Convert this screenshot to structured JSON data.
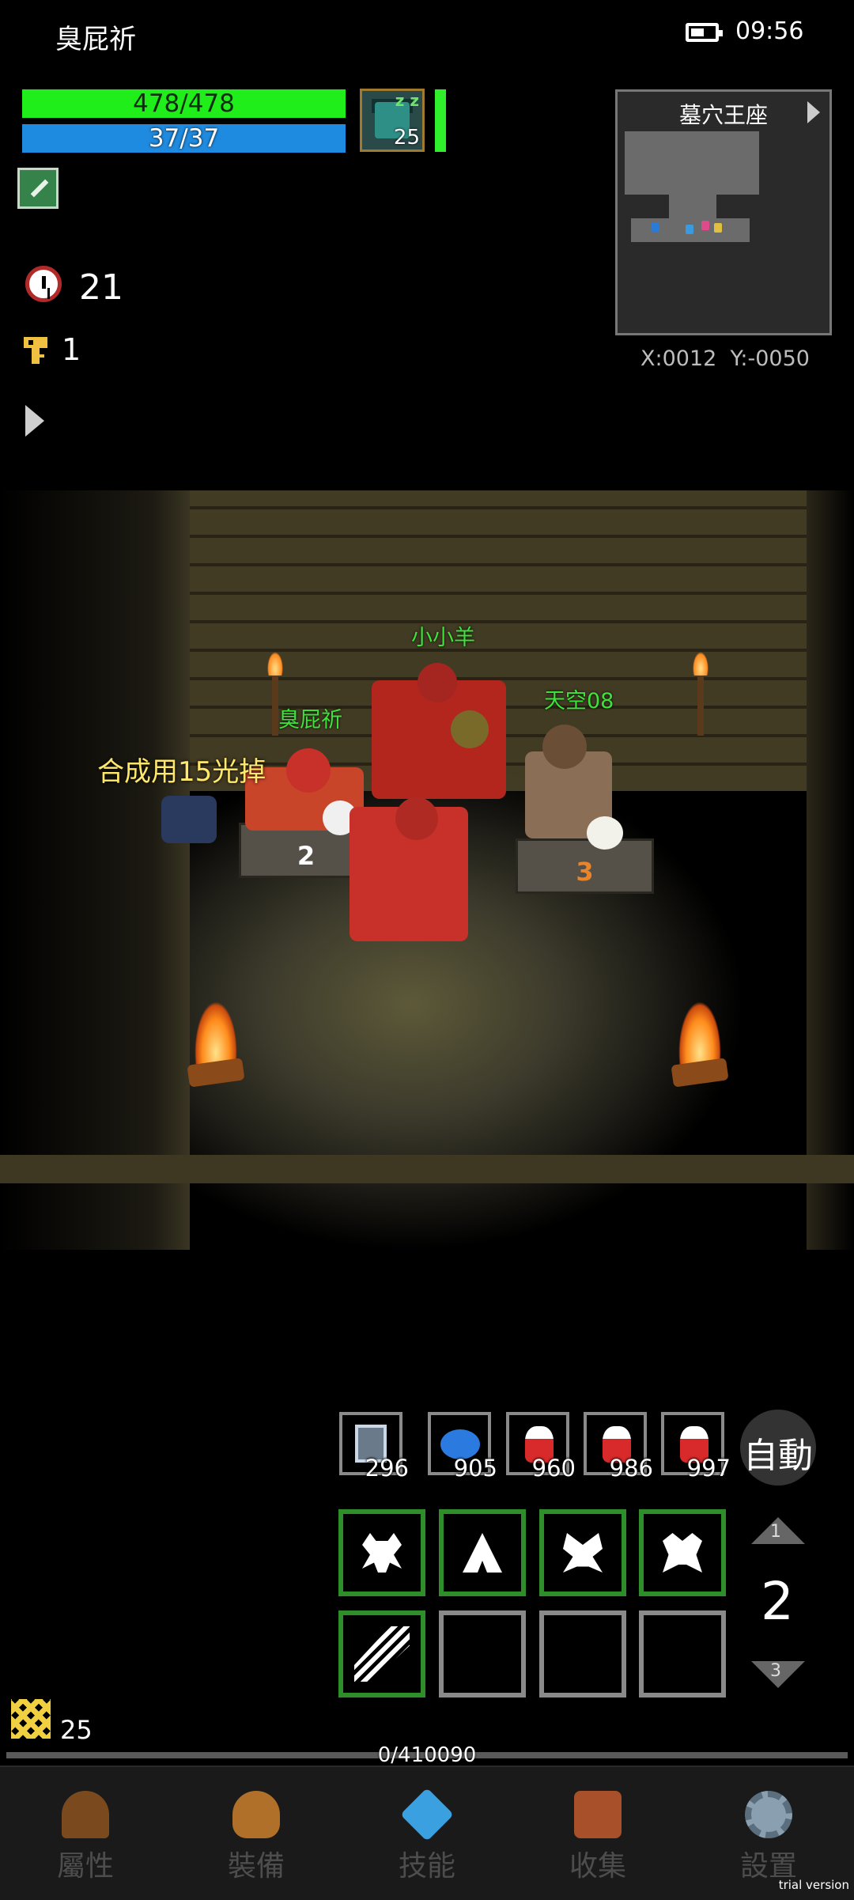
{
  "status_bar": {
    "player_name": "臭屁祈",
    "time": "09:56"
  },
  "player": {
    "hp": "478/478",
    "hp_fraction": 1.0,
    "mp": "37/37",
    "mp_fraction": 1.0,
    "portrait_level": "25",
    "sleep_mark": "z z",
    "timer_value": "21",
    "key_count": "1",
    "side_handle": "22"
  },
  "minimap": {
    "title": "墓穴王座",
    "coords": "X:0012  Y:-0050"
  },
  "scene": {
    "chat_message": "合成用15光掉",
    "names": [
      "小小羊",
      "天空08",
      "臭屁祈"
    ],
    "podiums": [
      "2",
      "3"
    ]
  },
  "consumables": [
    {
      "icon": "scroll-bottle-icon",
      "qty": "296"
    },
    {
      "icon": "blue-pouch-icon",
      "qty": "905"
    },
    {
      "icon": "red-potion-icon",
      "qty": "960"
    },
    {
      "icon": "red-potion-icon",
      "qty": "986"
    },
    {
      "icon": "red-potion-icon",
      "qty": "997"
    }
  ],
  "auto_button": "自動",
  "skill_pages": {
    "up": "1",
    "current": "2",
    "down": "3"
  },
  "bottom": {
    "level": "25",
    "exp": "0/410090",
    "exp_fraction": 0.0
  },
  "nav": [
    {
      "label": "屬性",
      "icon": "helmet-icon",
      "color": "#7a4a1e"
    },
    {
      "label": "裝備",
      "icon": "equipment-bag-icon",
      "color": "#b0702a"
    },
    {
      "label": "技能",
      "icon": "skill-gem-icon",
      "color": "#3aa0e0"
    },
    {
      "label": "收集",
      "icon": "book-icon",
      "color": "#a8502a"
    },
    {
      "label": "設置",
      "icon": "gear-icon",
      "color": "#8aa0b0"
    }
  ],
  "watermark": "trial version",
  "colors": {
    "hp": "#1fee1a",
    "mp": "#1f8be0",
    "name_tag": "#3fe23b",
    "chat": "#ffe86b",
    "skill_border": "#2e8f2a"
  }
}
